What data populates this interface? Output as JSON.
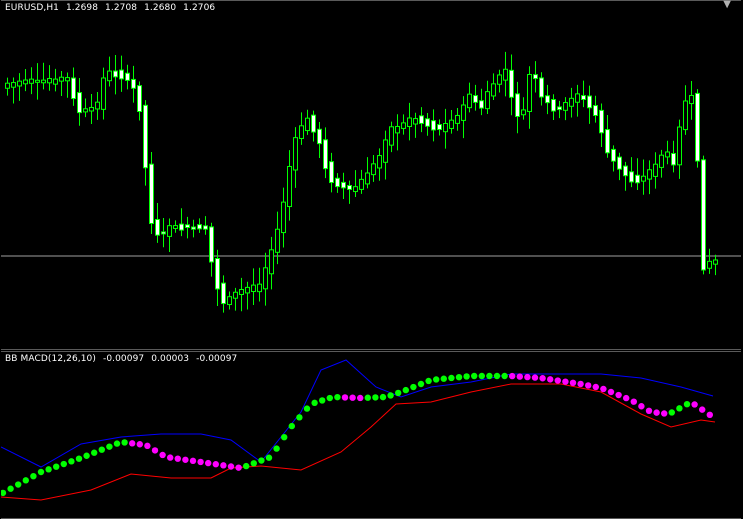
{
  "main_chart": {
    "symbol_timeframe": "EURUSD,H1",
    "open": "1.2698",
    "high": "1.2708",
    "low": "1.2680",
    "close": "1.2706",
    "horizontal_line_color": "#a0a0a0",
    "candle_color": "#00ff00",
    "bull_body_fill": "#000000",
    "bear_body_fill": "#ffffff"
  },
  "indicator": {
    "label": "BB MACD(12,26,10)",
    "value1": "-0.00097",
    "value2": "0.00003",
    "value3": "-0.00097",
    "upper_band_color": "#0000ff",
    "lower_band_color": "#ff0000",
    "dot_up_color": "#00ff00",
    "dot_down_color": "#ff00ff"
  },
  "icons": {
    "scroll_marker": "shift-triangle-icon"
  }
}
